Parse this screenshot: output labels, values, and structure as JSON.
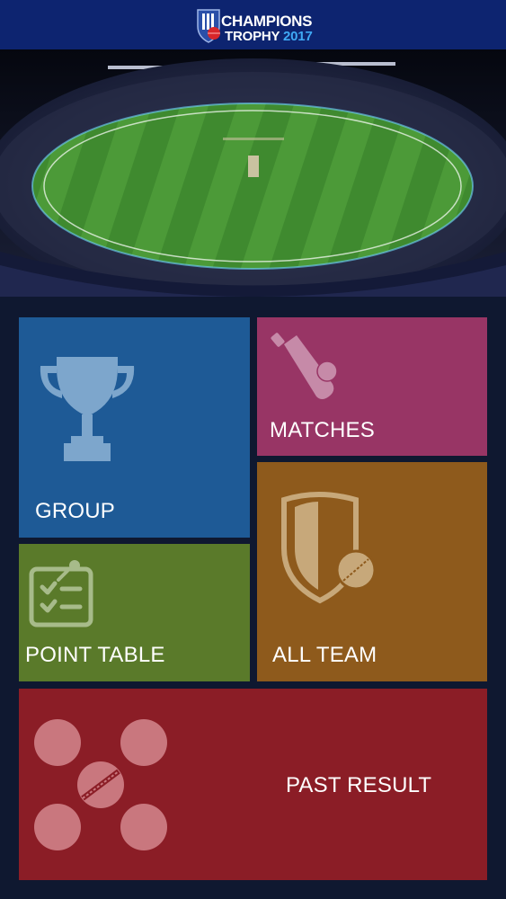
{
  "header": {
    "logo_line1": "CHAMPIONS",
    "logo_line2_word": "TROPHY",
    "logo_line2_year": "2017"
  },
  "hero": {
    "image": "cricket-stadium-photo"
  },
  "tiles": {
    "group": {
      "label": "GROUP",
      "icon": "trophy-icon",
      "color": "#1e5a96"
    },
    "matches": {
      "label": "MATCHES",
      "icon": "cricket-bat-ball-icon",
      "color": "#983565"
    },
    "point_table": {
      "label": "POINT TABLE",
      "icon": "clipboard-checklist-icon",
      "color": "#5a7a2a"
    },
    "all_team": {
      "label": "ALL TEAM",
      "icon": "shield-ball-icon",
      "color": "#8e5a1c"
    },
    "past_result": {
      "label": "PAST RESULT",
      "icon": "cricket-balls-icon",
      "color": "#8b1d26"
    }
  }
}
